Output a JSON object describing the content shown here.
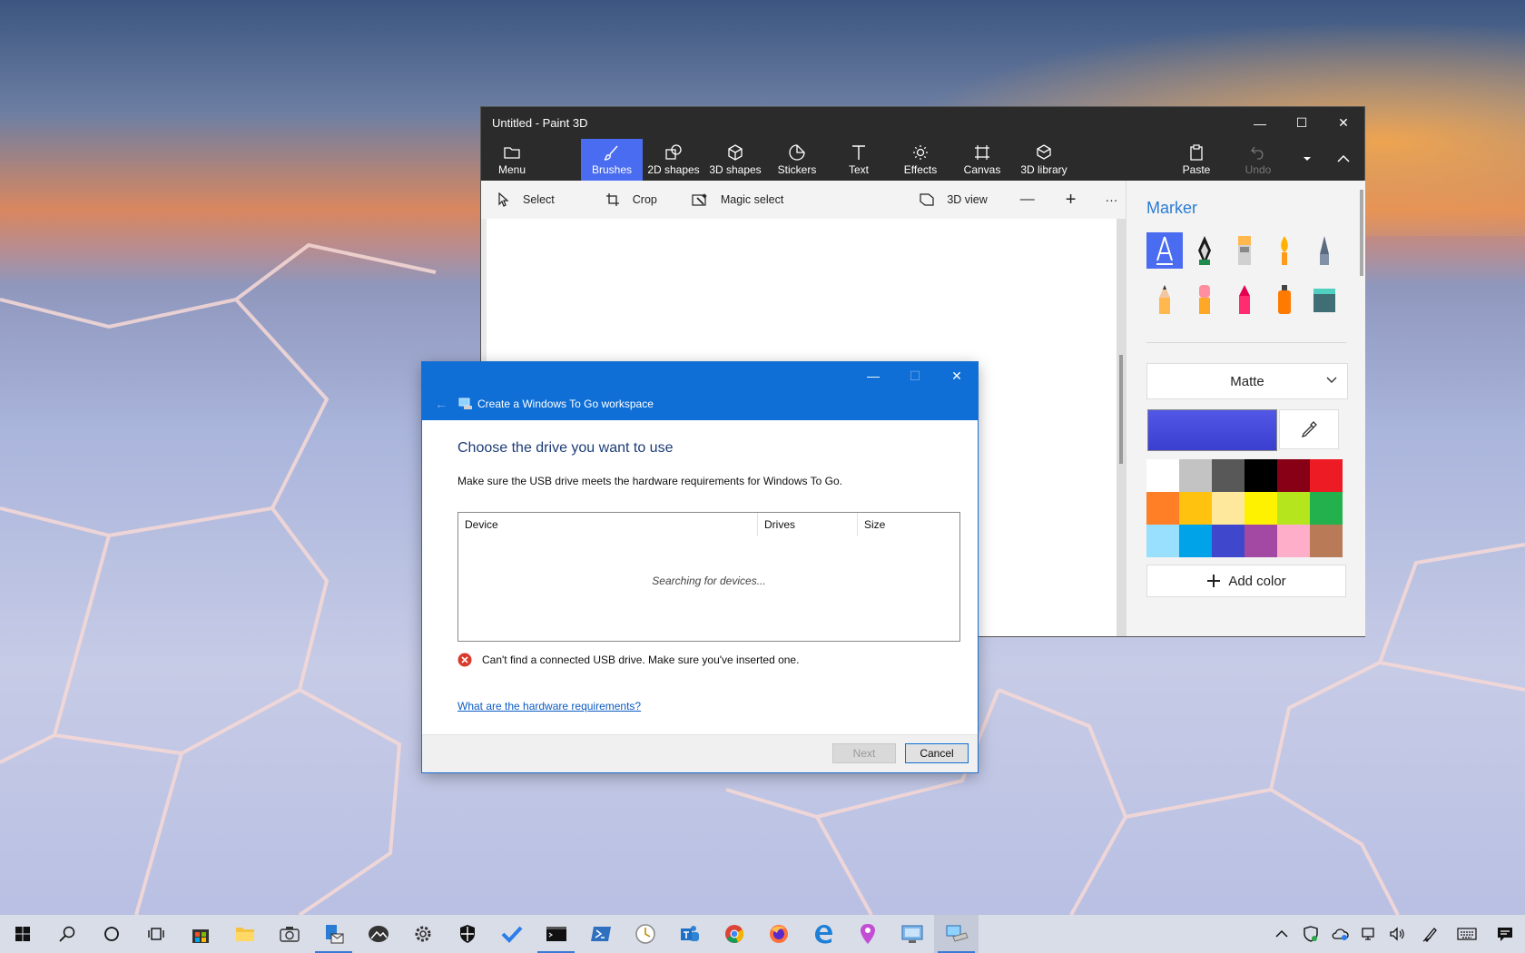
{
  "paint3d": {
    "title": "Untitled - Paint 3D",
    "window_controls": {
      "minimize": "—",
      "maximize": "☐",
      "close": "✕"
    },
    "toolbar": [
      {
        "label": "Menu",
        "icon": "folder-icon"
      },
      {
        "label": "Brushes",
        "icon": "brush-icon",
        "active": true
      },
      {
        "label": "2D shapes",
        "icon": "2d-shapes-icon"
      },
      {
        "label": "3D shapes",
        "icon": "cube-icon"
      },
      {
        "label": "Stickers",
        "icon": "sticker-icon"
      },
      {
        "label": "Text",
        "icon": "text-icon"
      },
      {
        "label": "Effects",
        "icon": "sun-icon"
      },
      {
        "label": "Canvas",
        "icon": "canvas-icon"
      },
      {
        "label": "3D library",
        "icon": "library-icon"
      },
      {
        "label": "Paste",
        "icon": "clipboard-icon"
      },
      {
        "label": "Undo",
        "icon": "undo-icon",
        "disabled": true
      }
    ],
    "subtoolbar": {
      "select": "Select",
      "crop": "Crop",
      "magic_select": "Magic select",
      "view_3d": "3D view",
      "zoom_out": "—",
      "zoom_in": "+",
      "more": "···"
    },
    "side_panel": {
      "title": "Marker",
      "finish": "Matte",
      "add_color": "Add color",
      "current_color": "#3b3fd0",
      "palette": [
        "#ffffff",
        "#c3c3c3",
        "#585858",
        "#000000",
        "#880015",
        "#ed1c24",
        "#ff7f27",
        "#ffc20e",
        "#fde89c",
        "#fff200",
        "#b5e61d",
        "#22b14c",
        "#99e0ff",
        "#00a2e8",
        "#3f48cc",
        "#a349a4",
        "#ffaec9",
        "#b97a57"
      ]
    }
  },
  "wtg_dialog": {
    "title": "Create a Windows To Go workspace",
    "heading": "Choose the drive you want to use",
    "description": "Make sure the USB drive meets the hardware requirements for Windows To Go.",
    "columns": [
      "Device",
      "Drives",
      "Size"
    ],
    "status": "Searching for devices...",
    "error": "Can't find a connected USB drive. Make sure you've inserted one.",
    "link": "What are the hardware requirements?",
    "next": "Next",
    "cancel": "Cancel"
  },
  "taskbar": {
    "accent": "#3b78d8",
    "apps": [
      "start-icon",
      "search-icon",
      "cortana-icon",
      "task-view-icon",
      "store-icon",
      "file-explorer-icon",
      "camera-icon",
      "mail-icon",
      "photos-icon",
      "settings-icon",
      "security-icon",
      "todo-icon",
      "terminal-icon",
      "powershell-icon",
      "clock-icon",
      "teams-icon",
      "chrome-icon",
      "firefox-icon",
      "edge-icon",
      "maps-icon",
      "remote-desktop-icon",
      "windows-to-go-icon"
    ]
  }
}
